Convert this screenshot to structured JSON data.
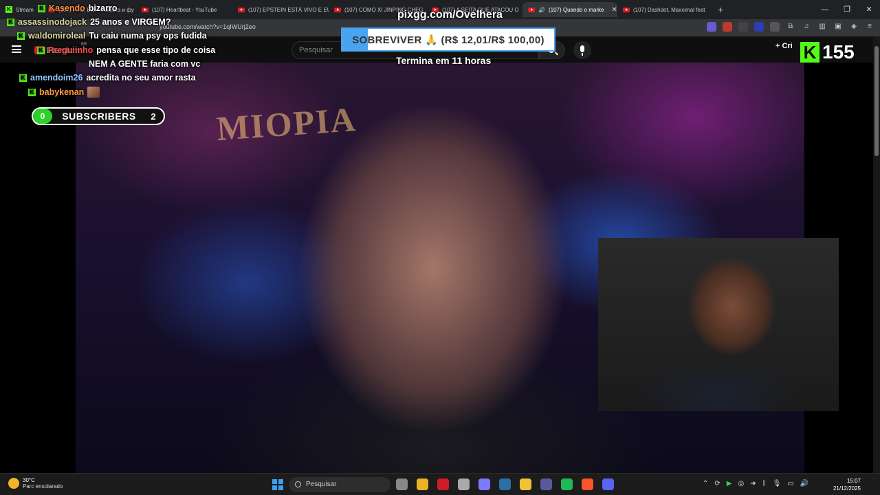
{
  "browser": {
    "tabs": [
      {
        "label": "Stream",
        "icon": "kick-icon",
        "active": false
      },
      {
        "label": "(107) И. С. Бах - Токката и фу",
        "icon": "youtube-icon",
        "active": false
      },
      {
        "label": "(107) Heartbeat - YouTube",
        "icon": "youtube-icon",
        "active": false
      },
      {
        "label": "(107) EPSTEIN ESTÁ VIVO E EU",
        "icon": "youtube-icon",
        "active": false
      },
      {
        "label": "(107) COMO XI JINPING CHEG",
        "icon": "youtube-icon",
        "active": false
      },
      {
        "label": "(107) A SEITA QUE ATACOU O",
        "icon": "youtube-icon",
        "active": false
      },
      {
        "label": "(107) Quando o marke",
        "icon": "youtube-icon",
        "active": true
      },
      {
        "label": "(107) Dashdot, Maxximal feat",
        "icon": "youtube-icon",
        "active": false
      }
    ],
    "url": "youtube.com/watch?v=1qIWUrj2eo",
    "new_tab": "+",
    "window_controls": [
      "—",
      "❐",
      "✕"
    ]
  },
  "youtube": {
    "logo_text": "Premium",
    "country": "BR",
    "search_placeholder": "Pesquisar",
    "create_label": "+ Cri",
    "video_text": "MIOPIA"
  },
  "chat": [
    {
      "user": "Kasendo",
      "text": "bizarro",
      "color": "#ff8a3d"
    },
    {
      "user": "assassinodojack",
      "text": "25 anos e VIRGEM?",
      "color": "#d8d4a0"
    },
    {
      "user": "waldomiroleal",
      "text": "Tu caiu numa psy ops fudida",
      "color": "#d8d4a0"
    },
    {
      "user": "Preguiinho",
      "text": "pensa que esse tipo de coisa",
      "color": "#ff4a4a"
    },
    {
      "user": "",
      "text": "NEM A GENTE faria com vc",
      "color": "#ffffff"
    },
    {
      "user": "amendoim26",
      "text": "acredita no seu amor rasta",
      "color": "#8fc7ff"
    },
    {
      "user": "babykenan",
      "text": "",
      "color": "#ff9b40"
    }
  ],
  "subscribers": {
    "left": "0",
    "label": "SUBSCRIBERS",
    "right": "2"
  },
  "goal": {
    "site": "pixgg.com/Ovelhera",
    "text": "SOBREVIVER 🙏 (R$ 12,01/R$ 100,00)",
    "progress": 0.12,
    "ends": "Termina em 11 horas"
  },
  "kick": {
    "badge": "K",
    "count": "155"
  },
  "taskbar": {
    "temp": "30°C",
    "weather": "Parc ensolarado",
    "search_placeholder": "Pesquisar",
    "time": "15:07",
    "date": "21/12/2025",
    "apps": [
      {
        "name": "task-view",
        "color": "#888888"
      },
      {
        "name": "chrome",
        "color": "#e8b325"
      },
      {
        "name": "opera",
        "color": "#d01c2a"
      },
      {
        "name": "app",
        "color": "#aaaaaa"
      },
      {
        "name": "app",
        "color": "#7a7aff"
      },
      {
        "name": "steam",
        "color": "#2a6fa8"
      },
      {
        "name": "explorer",
        "color": "#f2c236"
      },
      {
        "name": "app",
        "color": "#5a5a9a"
      },
      {
        "name": "spotify",
        "color": "#1db954"
      },
      {
        "name": "brave",
        "color": "#fb542b"
      },
      {
        "name": "discord",
        "color": "#5865f2"
      }
    ]
  }
}
